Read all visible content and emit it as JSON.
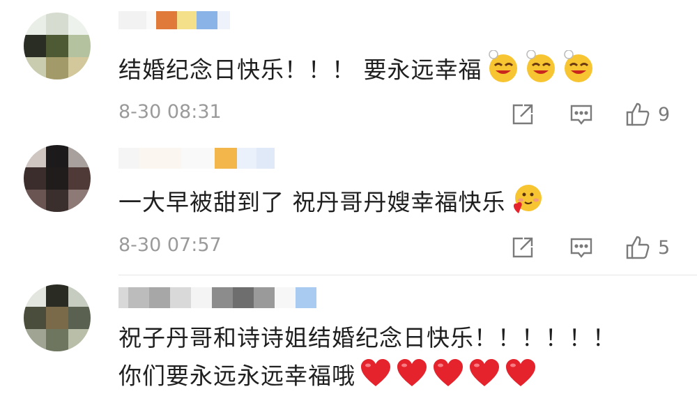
{
  "comments": [
    {
      "text": "结婚纪念日快乐！！！ 要永远幸福",
      "emojis": [
        "hee-hee-emoji",
        "hee-hee-emoji",
        "hee-hee-emoji"
      ],
      "time": "8-30 08:31",
      "likes": "9"
    },
    {
      "text": "一大早被甜到了 祝丹哥丹嫂幸福快乐",
      "emojis": [
        "blush-heart-emoji"
      ],
      "time": "8-30 07:57",
      "likes": "5"
    },
    {
      "text_line1": "祝子丹哥和诗诗姐结婚纪念日快乐！！！！！！",
      "text_line2": "你们要永远永远幸福哦",
      "emojis": [
        "red-heart-emoji",
        "red-heart-emoji",
        "red-heart-emoji",
        "red-heart-emoji",
        "red-heart-emoji"
      ]
    }
  ],
  "icons": {
    "share": "share-icon",
    "comment": "comment-icon",
    "like": "thumbs-up-icon"
  },
  "colors": {
    "text": "#1f1f1f",
    "meta": "#9a9a9a",
    "heart": "#e5232d",
    "emoji_face": "#f7c531"
  }
}
